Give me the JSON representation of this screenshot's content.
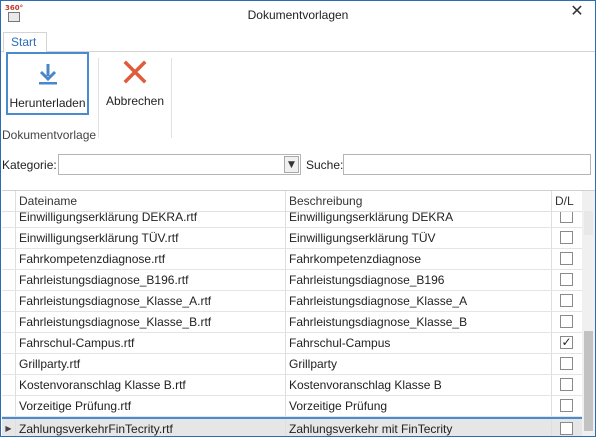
{
  "window": {
    "title": "Dokumentvorlagen",
    "app_icon_text": "360°"
  },
  "ribbon": {
    "tab_start": "Start",
    "download_label": "Herunterladen",
    "cancel_label": "Abbrechen",
    "group_label": "Dokumentvorlage"
  },
  "filter": {
    "category_label": "Kategorie:",
    "category_value": "",
    "search_label": "Suche:",
    "search_value": ""
  },
  "table": {
    "headers": {
      "name": "Dateiname",
      "desc": "Beschreibung",
      "dl": "D/L"
    },
    "rows": [
      {
        "name": "Einwilligungserklärung DEKRA.rtf",
        "desc": "Einwilligungserklärung DEKRA",
        "checked": false,
        "selected": false
      },
      {
        "name": "Einwilligungserklärung TÜV.rtf",
        "desc": "Einwilligungserklärung TÜV",
        "checked": false,
        "selected": false
      },
      {
        "name": "Fahrkompetenzdiagnose.rtf",
        "desc": "Fahrkompetenzdiagnose",
        "checked": false,
        "selected": false
      },
      {
        "name": "Fahrleistungsdiagnose_B196.rtf",
        "desc": "Fahrleistungsdiagnose_B196",
        "checked": false,
        "selected": false
      },
      {
        "name": "Fahrleistungsdiagnose_Klasse_A.rtf",
        "desc": "Fahrleistungsdiagnose_Klasse_A",
        "checked": false,
        "selected": false
      },
      {
        "name": "Fahrleistungsdiagnose_Klasse_B.rtf",
        "desc": "Fahrleistungsdiagnose_Klasse_B",
        "checked": false,
        "selected": false
      },
      {
        "name": "Fahrschul-Campus.rtf",
        "desc": "Fahrschul-Campus",
        "checked": true,
        "selected": false
      },
      {
        "name": "Grillparty.rtf",
        "desc": "Grillparty",
        "checked": false,
        "selected": false
      },
      {
        "name": "Kostenvoranschlag Klasse B.rtf",
        "desc": "Kostenvoranschlag Klasse B",
        "checked": false,
        "selected": false
      },
      {
        "name": "Vorzeitige Prüfung.rtf",
        "desc": "Vorzeitige Prüfung",
        "checked": false,
        "selected": false
      },
      {
        "name": "ZahlungsverkehrFinTecrity.rtf",
        "desc": "Zahlungsverkehr mit FinTecrity",
        "checked": false,
        "selected": true
      }
    ]
  },
  "icons": {
    "download": "download-icon",
    "cancel": "close-x-icon",
    "close": "close-icon",
    "combo": "chevron-down-icon",
    "row_pointer": "row-pointer-icon",
    "checkmark": "checkmark-icon"
  },
  "colors": {
    "accent": "#2b6cb3",
    "download_icon": "#4a86c8",
    "cancel_icon": "#e05b3c",
    "selected_row": "#e6e6e6"
  }
}
